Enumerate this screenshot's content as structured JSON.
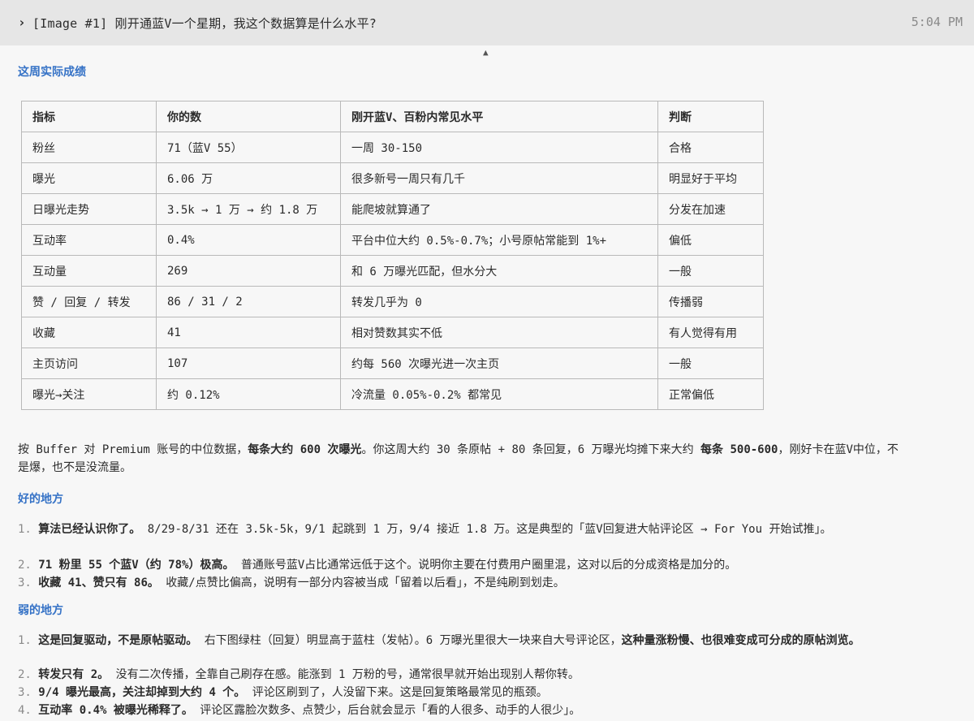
{
  "header": {
    "prompt": "[Image #1] 刚开通蓝V一个星期，我这个数据算是什么水平?",
    "time": "5:04 PM"
  },
  "section1": {
    "title": "这周实际成绩"
  },
  "table": {
    "headers": [
      "指标",
      "你的数",
      "刚开蓝V、百粉内常见水平",
      "判断"
    ],
    "rows": [
      [
        "粉丝",
        "71（蓝V 55）",
        "一周 30-150",
        "合格"
      ],
      [
        "曝光",
        "6.06 万",
        "很多新号一周只有几千",
        "明显好于平均"
      ],
      [
        "日曝光走势",
        "3.5k → 1 万 → 约 1.8 万",
        "能爬坡就算通了",
        "分发在加速"
      ],
      [
        "互动率",
        "0.4%",
        "平台中位大约 0.5%-0.7%；小号原帖常能到 1%+",
        "偏低"
      ],
      [
        "互动量",
        "269",
        "和 6 万曝光匹配，但水分大",
        "一般"
      ],
      [
        "赞 / 回复 / 转发",
        "86 / 31 / 2",
        "转发几乎为 0",
        "传播弱"
      ],
      [
        "收藏",
        "41",
        "相对赞数其实不低",
        "有人觉得有用"
      ],
      [
        "主页访问",
        "107",
        "约每 560 次曝光进一次主页",
        "一般"
      ],
      [
        "曝光→关注",
        "约 0.12%",
        "冷流量 0.05%-0.2% 都常见",
        "正常偏低"
      ]
    ]
  },
  "summary": {
    "a": "按 Buffer 对 Premium 账号的中位数据，",
    "b": "每条大约 600 次曝光",
    "c": "。你这周大约 30 条原帖 + 80 条回复，6 万曝光均摊下来大约 ",
    "d": "每条 500-600",
    "e": "，刚好卡在蓝V中位，不是爆，也不是没流量。"
  },
  "good": {
    "title": "好的地方",
    "items": [
      {
        "num": "1.",
        "bold": "算法已经认识你了。",
        "text": " 8/29-8/31 还在 3.5k-5k，9/1 起跳到 1 万，9/4 接近 1.8 万。这是典型的「蓝V回复进大帖评论区 → For You 开始试推」。"
      },
      {
        "num": "2.",
        "bold": "71 粉里 55 个蓝V（约 78%）极高。",
        "text": " 普通账号蓝V占比通常远低于这个。说明你主要在付费用户圈里混，这对以后的分成资格是加分的。"
      },
      {
        "num": "3.",
        "bold": "收藏 41、赞只有 86。",
        "text": " 收藏/点赞比偏高，说明有一部分内容被当成「留着以后看」，不是纯刷到划走。"
      }
    ]
  },
  "weak": {
    "title": "弱的地方",
    "items": [
      {
        "num": "1.",
        "bold": "这是回复驱动，不是原帖驱动。",
        "text": " 右下图绿柱（回复）明显高于蓝柱（发帖）。6 万曝光里很大一块来自大号评论区，",
        "bold2": "这种量涨粉慢、也很难变成可分成的原帖浏览。"
      },
      {
        "num": "2.",
        "bold": "转发只有 2。",
        "text": " 没有二次传播，全靠自己刷存在感。能涨到 1 万粉的号，通常很早就开始出现别人帮你转。"
      },
      {
        "num": "3.",
        "bold": "9/4 曝光最高，关注却掉到大约 4 个。",
        "text": " 评论区刷到了，人没留下来。这是回复策略最常见的瓶颈。"
      },
      {
        "num": "4.",
        "bold": "互动率 0.4% 被曝光稀释了。",
        "text": " 评论区露脸次数多、点赞少，后台就会显示「看的人很多、动手的人很少」。"
      }
    ]
  }
}
